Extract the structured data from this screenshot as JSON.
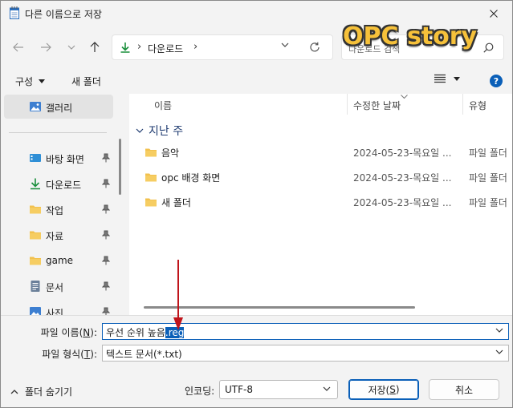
{
  "window": {
    "title": "다른 이름으로 저장"
  },
  "nav": {
    "breadcrumb": "다운로드",
    "search_placeholder": "다운로드 검색"
  },
  "watermark": "OPC story",
  "toolbar": {
    "organize_label": "구성",
    "new_folder_label": "새 폴더",
    "help_label": "?"
  },
  "sidebar": {
    "items": [
      {
        "label": "갤러리",
        "icon": "gallery-icon",
        "pinned": false
      },
      {
        "label": "바탕 화면",
        "icon": "desktop-icon",
        "pinned": true
      },
      {
        "label": "다운로드",
        "icon": "download-icon",
        "pinned": true
      },
      {
        "label": "작업",
        "icon": "folder-icon",
        "pinned": true
      },
      {
        "label": "자료",
        "icon": "folder-icon",
        "pinned": true
      },
      {
        "label": "game",
        "icon": "folder-icon",
        "pinned": true
      },
      {
        "label": "문서",
        "icon": "document-icon",
        "pinned": true
      },
      {
        "label": "사진",
        "icon": "pictures-icon",
        "pinned": true
      }
    ]
  },
  "columns": {
    "name": "이름",
    "modified": "수정한 날짜",
    "type": "유형"
  },
  "group": {
    "label": "지난 주"
  },
  "files": [
    {
      "name": "음악",
      "modified": "2024-05-23-목요일 ...",
      "type": "파일 폴더"
    },
    {
      "name": "opc 배경 화면",
      "modified": "2024-05-23-목요일 ...",
      "type": "파일 폴더"
    },
    {
      "name": "새 폴더",
      "modified": "2024-05-23-목요일 ...",
      "type": "파일 폴더"
    }
  ],
  "form": {
    "filename_label_pre": "파일 이름(",
    "filename_label_key": "N",
    "filename_label_post": "):",
    "filename_plain": "우선 순위 높음",
    "filename_selected": ".reg",
    "filetype_label_pre": "파일 형식(",
    "filetype_label_key": "T",
    "filetype_label_post": "):",
    "filetype_value": "텍스트 문서(*.txt)",
    "hide_folders_label": "폴더 숨기기",
    "encoding_label": "인코딩:",
    "encoding_value": "UTF-8",
    "save_label_pre": "저장(",
    "save_label_key": "S",
    "save_label_post": ")",
    "cancel_label": "취소"
  },
  "colors": {
    "accent": "#0a5fb8",
    "folder": "#f2c14e",
    "arrow": "#c0141b",
    "download": "#1a8f3c"
  }
}
